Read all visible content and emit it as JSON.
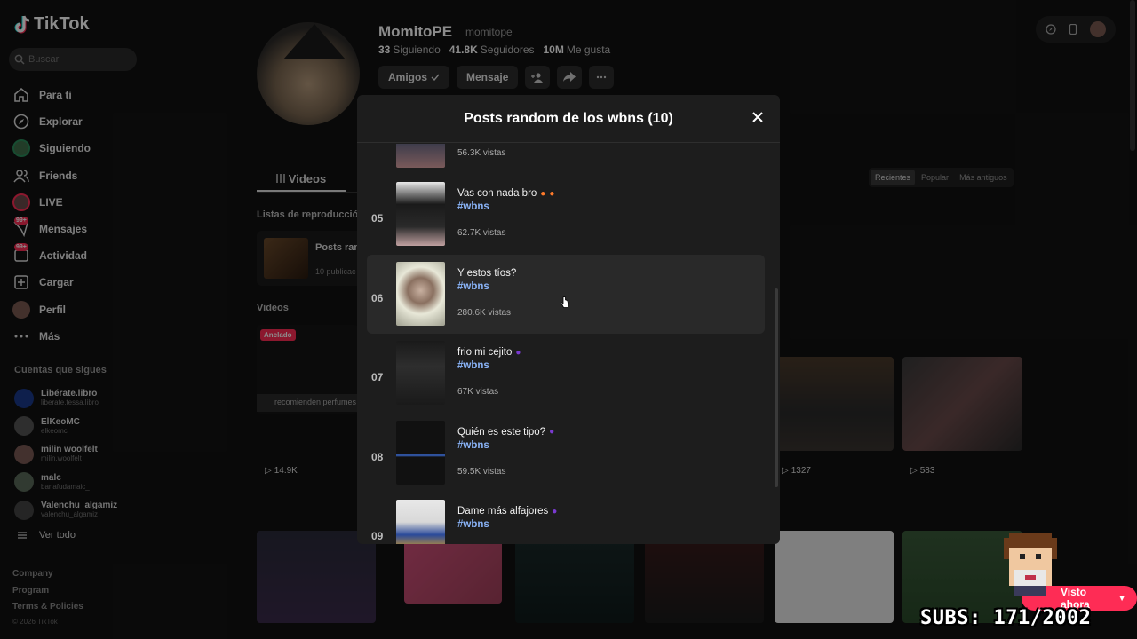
{
  "app": {
    "logo_text": "TikTok",
    "search_placeholder": "Buscar"
  },
  "nav": {
    "items": [
      {
        "label": "Para ti",
        "icon": "home-icon"
      },
      {
        "label": "Explorar",
        "icon": "compass-icon"
      },
      {
        "label": "Siguiendo",
        "icon": "following-avatar-icon"
      },
      {
        "label": "Friends",
        "icon": "friends-icon"
      },
      {
        "label": "LIVE",
        "icon": "live-icon"
      },
      {
        "label": "Mensajes",
        "icon": "messages-icon",
        "badge": "99+"
      },
      {
        "label": "Actividad",
        "icon": "activity-icon",
        "badge": "99+"
      },
      {
        "label": "Cargar",
        "icon": "upload-icon"
      },
      {
        "label": "Perfil",
        "icon": "profile-avatar-icon"
      },
      {
        "label": "Más",
        "icon": "more-icon"
      }
    ]
  },
  "following": {
    "title": "Cuentas que sigues",
    "accounts": [
      {
        "name": "Libérate.libro",
        "handle": "liberate.tessa.libro"
      },
      {
        "name": "ElKeoMC",
        "handle": "elkeomc"
      },
      {
        "name": "milin woolfelt",
        "handle": "milin.woolfelt"
      },
      {
        "name": "malc",
        "handle": "banafudamaic_"
      },
      {
        "name": "Valenchu_algamiz",
        "handle": "valenchu_algamiz"
      }
    ],
    "see_all": "Ver todo"
  },
  "footer": {
    "links": [
      "Company",
      "Program",
      "Terms & Policies"
    ],
    "copyright": "© 2026 TikTok"
  },
  "profile": {
    "display_name": "MomitoPE",
    "handle": "momitope",
    "stats": [
      {
        "value": "33",
        "label": "Siguiendo"
      },
      {
        "value": "41.8K",
        "label": "Seguidores"
      },
      {
        "value": "10M",
        "label": "Me gusta"
      }
    ],
    "buttons": {
      "friends": "Amigos",
      "message": "Mensaje"
    }
  },
  "content": {
    "tab_videos": "Videos",
    "sort": [
      "Recientes",
      "Popular",
      "Más antiguos"
    ],
    "lists_title": "Listas de reproducción",
    "playlist_name": "Posts ran",
    "playlist_count": "10 publicac",
    "videos_title": "Videos",
    "pinned_label": "Anclado",
    "pinned_caption": "recomienden perfumes",
    "video_views": [
      "14.9K",
      "1327",
      "583"
    ]
  },
  "modal": {
    "title": "Posts random de los wbns (10)",
    "posts": [
      {
        "num": "",
        "title": "",
        "tag": "",
        "views": "56.3K vistas"
      },
      {
        "num": "05",
        "title": "Vas con nada bro",
        "emoji": "fire",
        "tag": "#wbns",
        "views": "62.7K vistas"
      },
      {
        "num": "06",
        "title": "Y estos tíos?",
        "emoji": "",
        "tag": "#wbns",
        "views": "280.6K vistas"
      },
      {
        "num": "07",
        "title": "frio mi cejito",
        "emoji": "purple",
        "tag": "#wbns",
        "views": "67K vistas"
      },
      {
        "num": "08",
        "title": "Quién es este tipo?",
        "emoji": "purple",
        "tag": "#wbns",
        "views": "59.5K vistas"
      },
      {
        "num": "09",
        "title": "Dame más alfajores",
        "emoji": "purple",
        "tag": "#wbns",
        "views": ""
      }
    ]
  },
  "overlay": {
    "watch_now": "Visto ahora",
    "subs_counter": "SUBS: 171/2002"
  },
  "colors": {
    "accent": "#fe2c55",
    "hashtag": "#8ab4f8",
    "background": "#121212",
    "modal": "#1d1d1d"
  }
}
